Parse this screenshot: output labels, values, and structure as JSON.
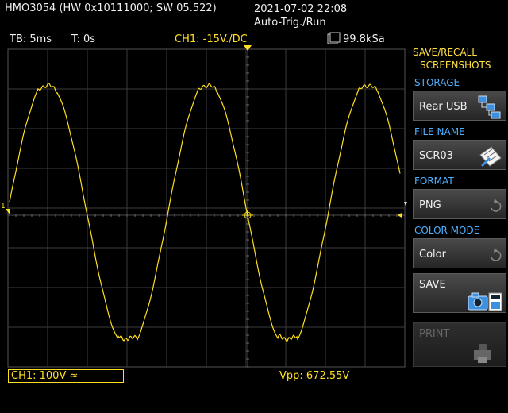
{
  "header": {
    "device": "HMO3054 (HW 0x10111000; SW 05.522)",
    "datetime": "2021-07-02 22:08",
    "trigger_mode": "Auto-Trig./Run"
  },
  "infobar": {
    "timebase": "TB: 5ms",
    "trigger_time": "T: 0s",
    "channel_setting": "CH1: -15V./DC",
    "sample_rate": "99.8kSa"
  },
  "panel": {
    "title_line1": "SAVE/RECALL",
    "title_line2": "SCREENSHOTS",
    "storage_label": "STORAGE",
    "storage_value": "Rear USB",
    "filename_label": "FILE NAME",
    "filename_value": "SCR03",
    "format_label": "FORMAT",
    "format_value": "PNG",
    "colormode_label": "COLOR MODE",
    "colormode_value": "Color",
    "save_label": "SAVE",
    "print_label": "PRINT"
  },
  "footer": {
    "ch1_scale": "CH1: 100V ≈",
    "measurement": "Vpp: 672.55V"
  },
  "colors": {
    "trace": "#ffe020",
    "accent": "#4fb0ff",
    "grid": "#3c3c3c"
  }
}
